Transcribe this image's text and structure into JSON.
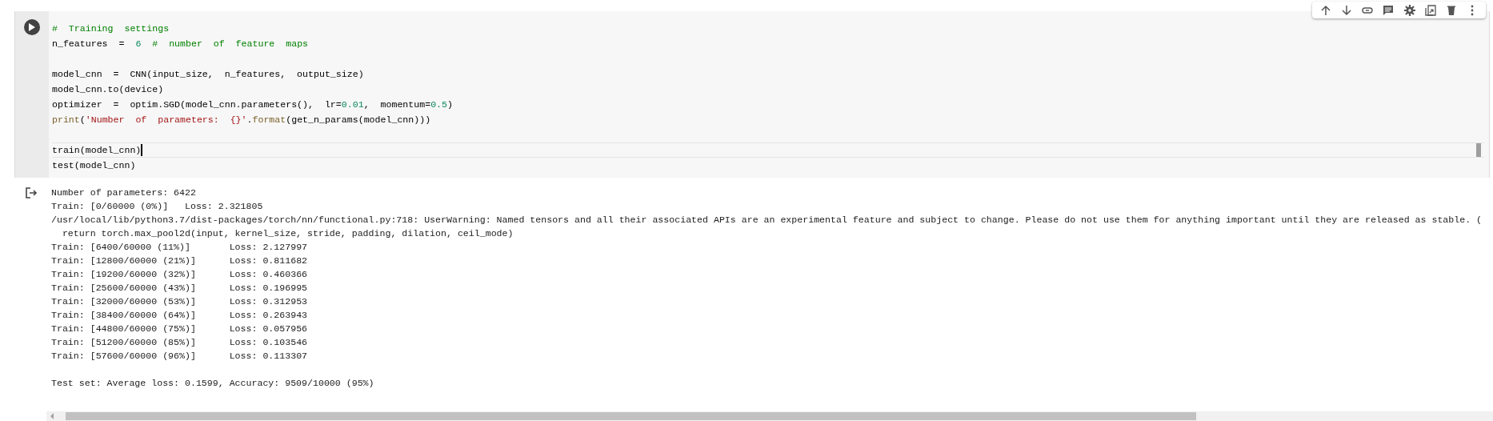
{
  "toolbar": {
    "buttons": [
      {
        "kind": "up"
      },
      {
        "kind": "down"
      },
      {
        "kind": "link"
      },
      {
        "kind": "comment"
      },
      {
        "kind": "settings"
      },
      {
        "kind": "mirror"
      },
      {
        "kind": "delete"
      },
      {
        "kind": "more"
      }
    ]
  },
  "code_cell": {
    "paragraphs": [
      {
        "lines": [
          {
            "active": false,
            "tokens": [
              {
                "kind": "comment",
                "text": "#  Training  settings"
              }
            ]
          },
          {
            "active": false,
            "tokens": [
              {
                "kind": "plain",
                "text": "n_features  =  "
              },
              {
                "kind": "number",
                "text": "6"
              },
              {
                "kind": "comment",
                "text": "  #  number  of  feature  maps"
              }
            ]
          }
        ]
      },
      {
        "lines": [
          {
            "active": false,
            "tokens": [
              {
                "kind": "plain",
                "text": "model_cnn  =  CNN(input_size,  n_features,  output_size)"
              }
            ]
          },
          {
            "active": false,
            "tokens": [
              {
                "kind": "plain",
                "text": "model_cnn.to(device)"
              }
            ]
          },
          {
            "active": false,
            "tokens": [
              {
                "kind": "plain",
                "text": "optimizer  =  optim.SGD(model_cnn.parameters(),  lr="
              },
              {
                "kind": "number",
                "text": "0.01"
              },
              {
                "kind": "plain",
                "text": ",  momentum="
              },
              {
                "kind": "number",
                "text": "0.5"
              },
              {
                "kind": "plain",
                "text": ")"
              }
            ]
          },
          {
            "active": false,
            "tokens": [
              {
                "kind": "builtin",
                "text": "print"
              },
              {
                "kind": "plain",
                "text": "("
              },
              {
                "kind": "string",
                "text": "'Number  of  parameters:  {}'"
              },
              {
                "kind": "plain",
                "text": "."
              },
              {
                "kind": "builtin",
                "text": "format"
              },
              {
                "kind": "plain",
                "text": "(get_n_params(model_cnn)))"
              }
            ]
          }
        ]
      },
      {
        "lines": [
          {
            "active": true,
            "tokens": [
              {
                "kind": "plain",
                "text": "train(model_cnn)"
              }
            ]
          },
          {
            "active": false,
            "tokens": [
              {
                "kind": "plain",
                "text": "test(model_cnn)"
              }
            ]
          }
        ]
      }
    ]
  },
  "output": {
    "paragraphs": [
      {
        "lines": [
          "Number of parameters: 6422",
          "Train: [0/60000 (0%)]\tLoss: 2.321805",
          "/usr/local/lib/python3.7/dist-packages/torch/nn/functional.py:718: UserWarning: Named tensors and all their associated APIs are an experimental feature and subject to change. Please do not use them for anything important until they are released as stable. (",
          "  return torch.max_pool2d(input, kernel_size, stride, padding, dilation, ceil_mode)",
          "Train: [6400/60000 (11%)]\tLoss: 2.127997",
          "Train: [12800/60000 (21%)]\tLoss: 0.811682",
          "Train: [19200/60000 (32%)]\tLoss: 0.460366",
          "Train: [25600/60000 (43%)]\tLoss: 0.196995",
          "Train: [32000/60000 (53%)]\tLoss: 0.312953",
          "Train: [38400/60000 (64%)]\tLoss: 0.263943",
          "Train: [44800/60000 (75%)]\tLoss: 0.057956",
          "Train: [51200/60000 (85%)]\tLoss: 0.103546",
          "Train: [57600/60000 (96%)]\tLoss: 0.113307"
        ]
      },
      {
        "lines": [
          "Test set: Average loss: 0.1599, Accuracy: 9509/10000 (95%)"
        ]
      }
    ]
  }
}
